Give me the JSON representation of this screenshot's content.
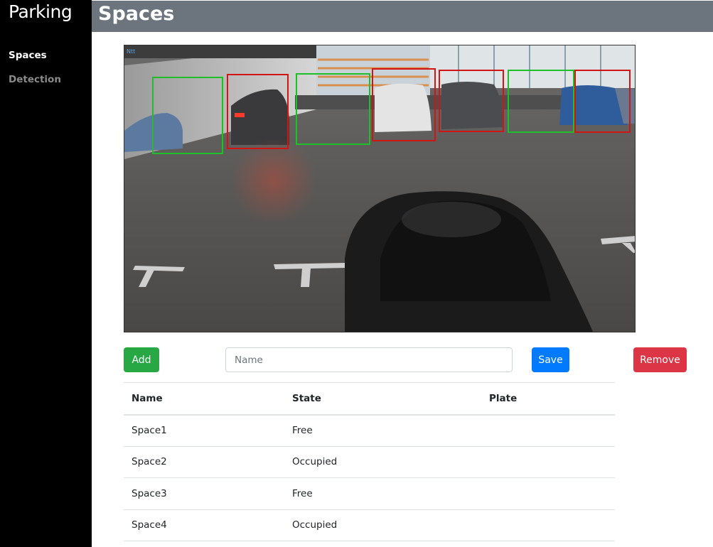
{
  "sidebar": {
    "brand": "Parking",
    "items": [
      {
        "label": "Spaces",
        "active": true
      },
      {
        "label": "Detection",
        "active": false
      }
    ]
  },
  "header": {
    "title": "Spaces"
  },
  "camera": {
    "timestamp": "Ntt",
    "box_colors": {
      "free": "#1fbf2a",
      "occupied": "#d11515"
    },
    "spaces": [
      {
        "state": "Free"
      },
      {
        "state": "Occupied"
      },
      {
        "state": "Free"
      },
      {
        "state": "Occupied"
      },
      {
        "state": "Occupied"
      },
      {
        "state": "Free"
      },
      {
        "state": "Occupied"
      }
    ]
  },
  "form": {
    "add_label": "Add",
    "name_placeholder": "Name",
    "name_value": "",
    "save_label": "Save",
    "remove_label": "Remove"
  },
  "table": {
    "headers": [
      "Name",
      "State",
      "Plate"
    ],
    "rows": [
      {
        "name": "Space1",
        "state": "Free",
        "plate": ""
      },
      {
        "name": "Space2",
        "state": "Occupied",
        "plate": ""
      },
      {
        "name": "Space3",
        "state": "Free",
        "plate": ""
      },
      {
        "name": "Space4",
        "state": "Occupied",
        "plate": ""
      }
    ]
  }
}
